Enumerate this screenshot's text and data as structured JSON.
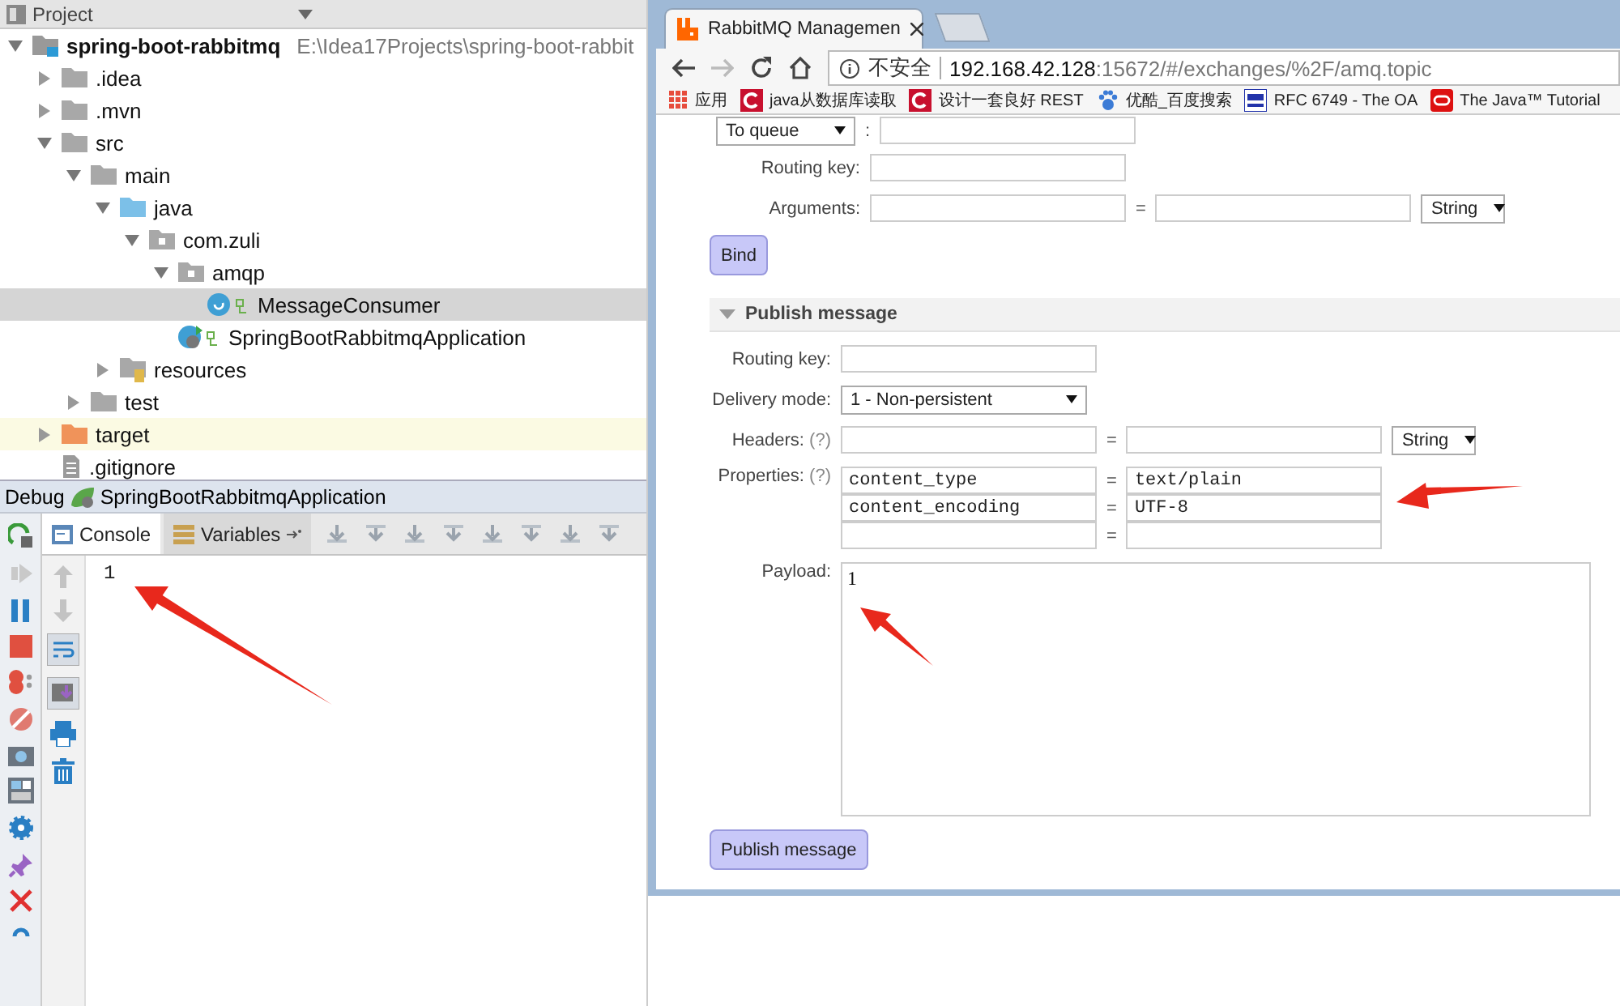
{
  "project_panel": {
    "title": "Project",
    "tree": [
      {
        "name": "spring-boot-rabbitmq",
        "path": "E:\\Idea17Projects\\spring-boot-rabbit",
        "kind": "module",
        "expanded": true,
        "selected": false,
        "children": [
          {
            "name": ".idea",
            "kind": "folder",
            "expanded": false,
            "selected": false
          },
          {
            "name": ".mvn",
            "kind": "folder",
            "expanded": false,
            "selected": false
          },
          {
            "name": "src",
            "kind": "folder",
            "expanded": true,
            "selected": false,
            "children": [
              {
                "name": "main",
                "kind": "folder",
                "expanded": true,
                "selected": false,
                "children": [
                  {
                    "name": "java",
                    "kind": "source-folder",
                    "expanded": true,
                    "selected": false,
                    "children": [
                      {
                        "name": "com.zuli",
                        "kind": "package",
                        "expanded": true,
                        "selected": false,
                        "children": [
                          {
                            "name": "amqp",
                            "kind": "package",
                            "expanded": true,
                            "selected": false,
                            "children": [
                              {
                                "name": "MessageConsumer",
                                "kind": "class",
                                "selected": true
                              }
                            ]
                          },
                          {
                            "name": "SpringBootRabbitmqApplication",
                            "kind": "app-class",
                            "selected": false
                          }
                        ]
                      }
                    ]
                  },
                  {
                    "name": "resources",
                    "kind": "resources",
                    "expanded": false,
                    "selected": false
                  }
                ]
              },
              {
                "name": "test",
                "kind": "folder",
                "expanded": false,
                "selected": false
              }
            ]
          },
          {
            "name": "target",
            "kind": "excluded",
            "expanded": false,
            "selected": false
          },
          {
            "name": ".gitignore",
            "kind": "file",
            "selected": false
          }
        ]
      }
    ]
  },
  "debug_panel": {
    "title": "Debug",
    "config": "SpringBootRabbitmqApplication",
    "tabs": [
      {
        "label": "Console",
        "selected": true
      },
      {
        "label": "Variables",
        "selected": false
      }
    ],
    "console_output": "1"
  },
  "browser": {
    "tabs": [
      {
        "title": "RabbitMQ Managemen",
        "selected": true
      }
    ],
    "address": {
      "security": "不安全",
      "host": "192.168.42.128",
      "rest": ":15672/#/exchanges/%2F/amq.topic"
    },
    "bookmarks": [
      {
        "label": "应用",
        "kind": "apps"
      },
      {
        "label": "java从数据库读取",
        "kind": "c-logo"
      },
      {
        "label": "设计一套良好 REST",
        "kind": "c-logo"
      },
      {
        "label": "优酷_百度搜索",
        "kind": "paw"
      },
      {
        "label": "RFC 6749 - The OA",
        "kind": "rfc"
      },
      {
        "label": "The Java™ Tutorial",
        "kind": "oracle"
      }
    ],
    "bind": {
      "destination": "To queue",
      "separator": ":",
      "rows": [
        {
          "label": "Routing key:",
          "kind": "text"
        },
        {
          "label": "Arguments:",
          "kind": "pair",
          "equals": "=",
          "type": "String"
        }
      ],
      "button": "Bind"
    },
    "publish": {
      "title": "Publish message",
      "expanded": true,
      "rows": [
        {
          "label": "Routing key:",
          "kind": "text"
        },
        {
          "label": "Delivery mode:",
          "kind": "select",
          "value": "1 - Non-persistent"
        },
        {
          "label": "Headers:",
          "help": "(?)",
          "kind": "pair",
          "equals": "=",
          "type": "String"
        },
        {
          "label": "Properties:",
          "help": "(?)",
          "kind": "properties",
          "pairs": [
            {
              "key": "content_type",
              "equals": "=",
              "value": "text/plain"
            },
            {
              "key": "content_encoding",
              "equals": "=",
              "value": "UTF-8"
            },
            {
              "equals": "="
            }
          ]
        },
        {
          "label": "Payload:",
          "kind": "textarea",
          "value": "1"
        }
      ],
      "button": "Publish message"
    }
  }
}
